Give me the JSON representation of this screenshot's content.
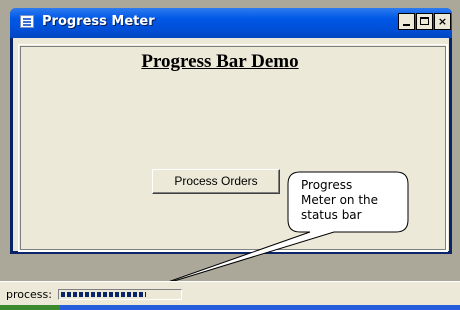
{
  "window": {
    "title": "Progress Meter",
    "controls": {
      "minimize": "",
      "maximize": "",
      "close": "×"
    }
  },
  "form": {
    "heading": "Progress Bar Demo",
    "process_button_label": "Process Orders"
  },
  "callout": {
    "line1": "Progress",
    "line2": "Meter on the",
    "line3": "status bar"
  },
  "statusbar": {
    "label": "process:",
    "progress": 0.72
  },
  "colors": {
    "titlebar": "#0058e6",
    "meter_fill": "#0a246a",
    "form_bg": "#ece9d8"
  }
}
